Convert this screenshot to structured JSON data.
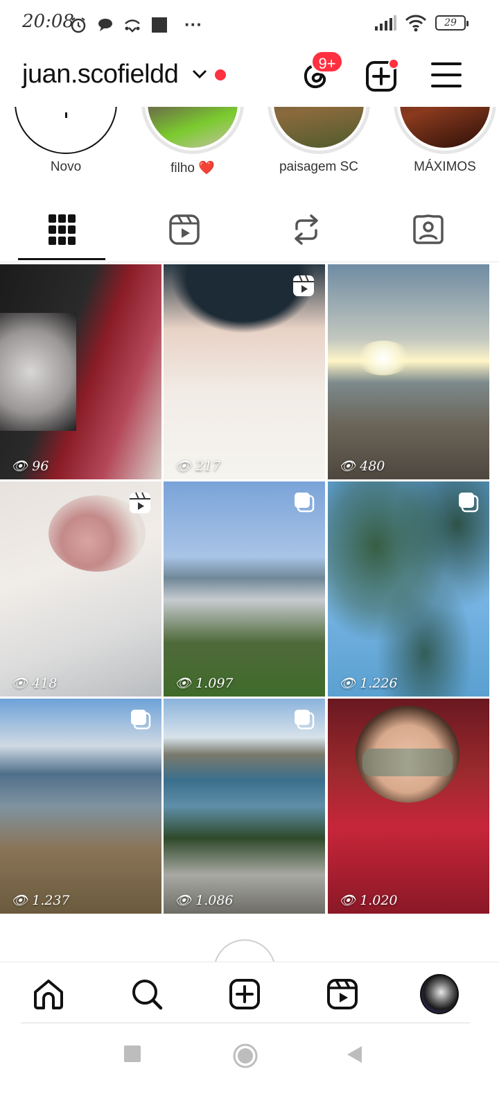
{
  "status_bar": {
    "time": "20:08",
    "more": "···",
    "battery": "29"
  },
  "header": {
    "username": "juan.scofieldd",
    "threads_badge": "9+"
  },
  "highlights": [
    {
      "label": "Novo"
    },
    {
      "label": "filho ❤️"
    },
    {
      "label": "paisagem SC"
    },
    {
      "label": "MÁXIMOS"
    }
  ],
  "tabs": [
    "grid",
    "reels",
    "reposts",
    "tagged"
  ],
  "posts": [
    {
      "views": "96",
      "type": "photo"
    },
    {
      "views": "217",
      "type": "reel"
    },
    {
      "views": "480",
      "type": "photo"
    },
    {
      "views": "418",
      "type": "reel"
    },
    {
      "views": "1.097",
      "type": "carousel"
    },
    {
      "views": "1.226",
      "type": "carousel"
    },
    {
      "views": "1.237",
      "type": "carousel"
    },
    {
      "views": "1.086",
      "type": "carousel"
    },
    {
      "views": "1.020",
      "type": "photo"
    }
  ],
  "colors": {
    "accent_red": "#ff3040",
    "text": "#111111",
    "divider": "#e6e6e6"
  },
  "bottom_nav": [
    "home-icon",
    "search-icon",
    "create-icon",
    "reels-icon",
    "profile-avatar"
  ],
  "system_nav": [
    "recents-button",
    "home-button",
    "back-button"
  ]
}
